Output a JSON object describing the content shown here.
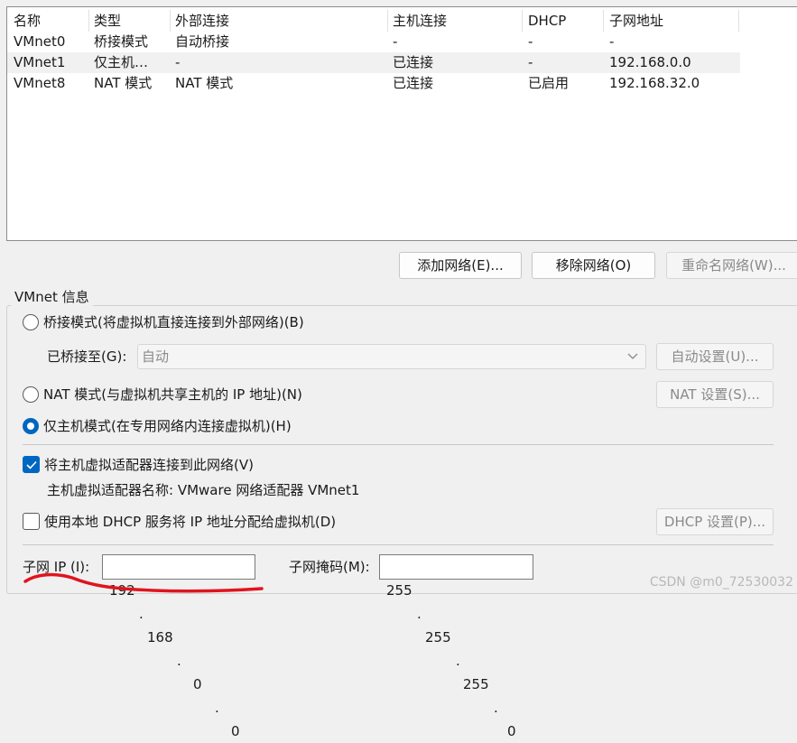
{
  "table": {
    "columns": [
      "名称",
      "类型",
      "外部连接",
      "主机连接",
      "DHCP",
      "子网地址"
    ],
    "rows": [
      [
        "VMnet0",
        "桥接模式",
        "自动桥接",
        "-",
        "-",
        "-"
      ],
      [
        "VMnet1",
        "仅主机…",
        "-",
        "已连接",
        "-",
        "192.168.0.0"
      ],
      [
        "VMnet8",
        "NAT 模式",
        "NAT 模式",
        "已连接",
        "已启用",
        "192.168.32.0"
      ]
    ],
    "selected_row": 1
  },
  "buttons": {
    "add_network": "添加网络(E)...",
    "remove_network": "移除网络(O)",
    "rename_network": "重命名网络(W)..."
  },
  "vmnet_info": {
    "group_title": "VMnet 信息",
    "bridged_label": "桥接模式(将虚拟机直接连接到外部网络)(B)",
    "bridged_to_label": "已桥接至(G):",
    "bridged_to_value": "自动",
    "auto_settings": "自动设置(U)...",
    "nat_label": "NAT 模式(与虚拟机共享主机的 IP 地址)(N)",
    "nat_settings": "NAT 设置(S)...",
    "host_only_label": "仅主机模式(在专用网络内连接虚拟机)(H)",
    "selected_mode": "host_only",
    "connect_adapter_label": "将主机虚拟适配器连接到此网络(V)",
    "connect_adapter_checked": true,
    "adapter_name_label": "主机虚拟适配器名称: VMware 网络适配器 VMnet1",
    "use_dhcp_label": "使用本地 DHCP 服务将 IP 地址分配给虚拟机(D)",
    "use_dhcp_checked": false,
    "dhcp_settings": "DHCP 设置(P)...",
    "subnet_ip_label": "子网 IP (I):",
    "subnet_ip": [
      "192",
      "168",
      "0",
      "0"
    ],
    "subnet_mask_label": "子网掩码(M):",
    "subnet_mask": [
      "255",
      "255",
      "255",
      "0"
    ]
  },
  "watermark": "CSDN @m0_72530032",
  "colors": {
    "accent": "#0067c0",
    "annotation": "#e0141e"
  }
}
